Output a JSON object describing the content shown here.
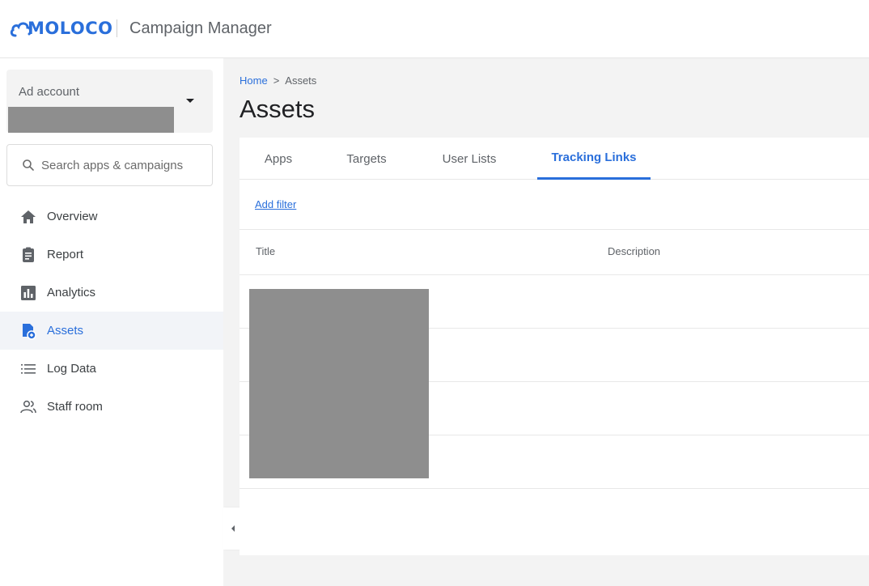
{
  "header": {
    "logo_text": "MOLOCO",
    "title": "Campaign Manager"
  },
  "sidebar": {
    "account_label": "Ad account",
    "search_placeholder": "Search apps & campaigns",
    "items": [
      {
        "label": "Overview",
        "icon": "home-icon"
      },
      {
        "label": "Report",
        "icon": "clipboard-icon"
      },
      {
        "label": "Analytics",
        "icon": "bar-chart-icon"
      },
      {
        "label": "Assets",
        "icon": "assets-icon",
        "active": true
      },
      {
        "label": "Log Data",
        "icon": "list-icon"
      },
      {
        "label": "Staff room",
        "icon": "people-icon"
      }
    ]
  },
  "breadcrumb": {
    "home": "Home",
    "separator": ">",
    "current": "Assets"
  },
  "page_title": "Assets",
  "tabs": [
    {
      "label": "Apps"
    },
    {
      "label": "Targets"
    },
    {
      "label": "User Lists"
    },
    {
      "label": "Tracking Links",
      "active": true
    }
  ],
  "add_filter": "Add filter",
  "table": {
    "columns": [
      "Title",
      "Description"
    ]
  },
  "colors": {
    "accent": "#2a6fdb",
    "redaction": "#8e8e8e"
  }
}
